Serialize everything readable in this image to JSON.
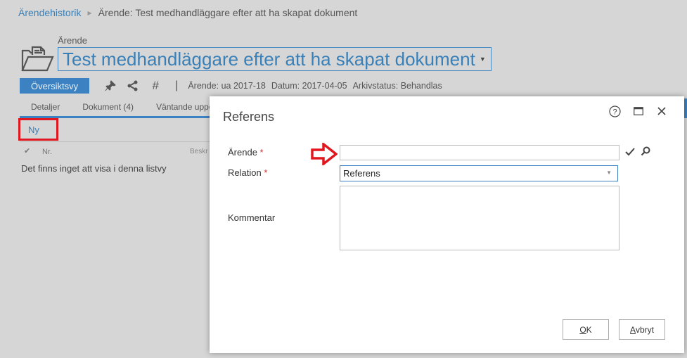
{
  "breadcrumb": {
    "parent": "Ärendehistorik",
    "current": "Ärende: Test medhandläggare efter att ha skapat dokument"
  },
  "case": {
    "label": "Ärende",
    "title": "Test medhandläggare efter att ha skapat dokument"
  },
  "toolbar": {
    "overview_label": "Översiktsvy",
    "icons": [
      "pin-icon",
      "share-icon",
      "hash-icon"
    ],
    "meta": [
      {
        "key": "Ärende:",
        "value": "ua 2017-18"
      },
      {
        "key": "Datum:",
        "value": "2017-04-05"
      },
      {
        "key": "Arkivstatus:",
        "value": "Behandlas"
      }
    ]
  },
  "tabs": [
    {
      "label": "Detaljer"
    },
    {
      "label": "Dokument (4)"
    },
    {
      "label": "Väntande uppgi"
    }
  ],
  "list": {
    "new_label": "Ny",
    "columns": [
      "Nr.",
      "Beskr"
    ],
    "empty_message": "Det finns inget att visa i denna listvy"
  },
  "dialog": {
    "title": "Referens",
    "fields": {
      "arende": {
        "label": "Ärende",
        "required_mark": "*",
        "value": ""
      },
      "relation": {
        "label": "Relation",
        "required_mark": "*",
        "value": "Referens"
      },
      "kommentar": {
        "label": "Kommentar",
        "value": ""
      }
    },
    "buttons": {
      "ok_accel": "O",
      "ok_rest": "K",
      "cancel_accel": "A",
      "cancel_rest": "vbryt"
    }
  },
  "colors": {
    "accent": "#3c82c2",
    "highlight_red": "#e0171f",
    "background": "#d6d6d6"
  }
}
